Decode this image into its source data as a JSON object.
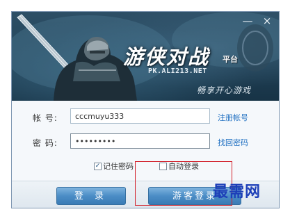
{
  "window": {
    "minimize_glyph": "—",
    "close_glyph": "×"
  },
  "banner": {
    "logo_main": "游侠对战",
    "logo_sub": "平台",
    "url": "PK.ALI213.NET",
    "slogan": "畅享开心游戏"
  },
  "form": {
    "account_label": "帐  号:",
    "account_value": "cccmuyu333",
    "register_link": "注册帐号",
    "password_label": "密  码:",
    "password_value": "passwords",
    "recover_link": "找回密码"
  },
  "options": {
    "remember_label": "记住密码",
    "remember_checked": true,
    "auto_login_label": "自动登录",
    "auto_login_checked": false
  },
  "buttons": {
    "login_label": "登 录",
    "guest_label": "游客登录"
  },
  "watermark": "最需网",
  "colors": {
    "accent": "#4b8dc6",
    "link": "#1f6fc1",
    "highlight": "#d2202a",
    "watermark": "#1d3fb8"
  }
}
